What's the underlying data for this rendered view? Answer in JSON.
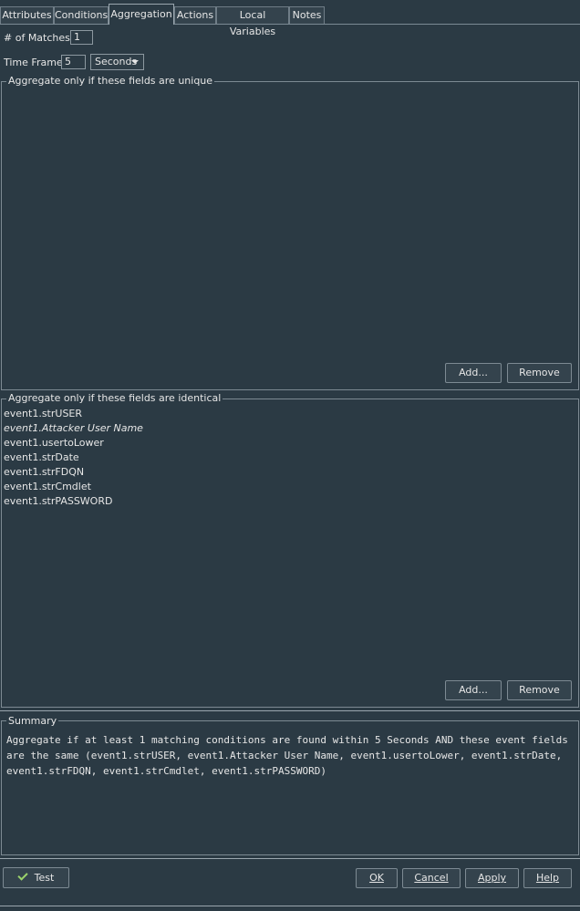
{
  "tabs": [
    {
      "label": "Attributes"
    },
    {
      "label": "Conditions"
    },
    {
      "label": "Aggregation",
      "active": true
    },
    {
      "label": "Actions"
    },
    {
      "label": "Local Variables"
    },
    {
      "label": "Notes"
    }
  ],
  "matches": {
    "label": "# of Matches:",
    "value": "1"
  },
  "timeframe": {
    "label": "Time Frame:",
    "value": "5",
    "unit": "Seconds"
  },
  "unique_group": {
    "title": "Aggregate only if these fields are unique",
    "items": [],
    "add_label": "Add...",
    "remove_label": "Remove"
  },
  "identical_group": {
    "title": "Aggregate only if these fields are identical",
    "items": [
      {
        "text": "event1.strUSER",
        "italic": false
      },
      {
        "text": "event1.Attacker User Name",
        "italic": true
      },
      {
        "text": "event1.usertoLower",
        "italic": false
      },
      {
        "text": "event1.strDate",
        "italic": false
      },
      {
        "text": "event1.strFDQN",
        "italic": false
      },
      {
        "text": "event1.strCmdlet",
        "italic": false
      },
      {
        "text": "event1.strPASSWORD",
        "italic": false
      }
    ],
    "add_label": "Add...",
    "remove_label": "Remove"
  },
  "summary": {
    "title": "Summary",
    "text": "Aggregate if at least 1 matching conditions are found within 5 Seconds AND these event fields are the same (event1.strUSER, event1.Attacker User Name, event1.usertoLower, event1.strDate, event1.strFDQN, event1.strCmdlet, event1.strPASSWORD)"
  },
  "footer": {
    "test_label": "Test",
    "ok_label": "OK",
    "cancel_label": "Cancel",
    "apply_label": "Apply",
    "help_label": "Help"
  },
  "colors": {
    "background": "#2b3a44",
    "border": "#7d8a93",
    "text": "#e6e6e6",
    "check": "#9bd36b"
  },
  "icons": {
    "test": "checkmark-icon",
    "dropdown": "chevron-down-icon"
  }
}
